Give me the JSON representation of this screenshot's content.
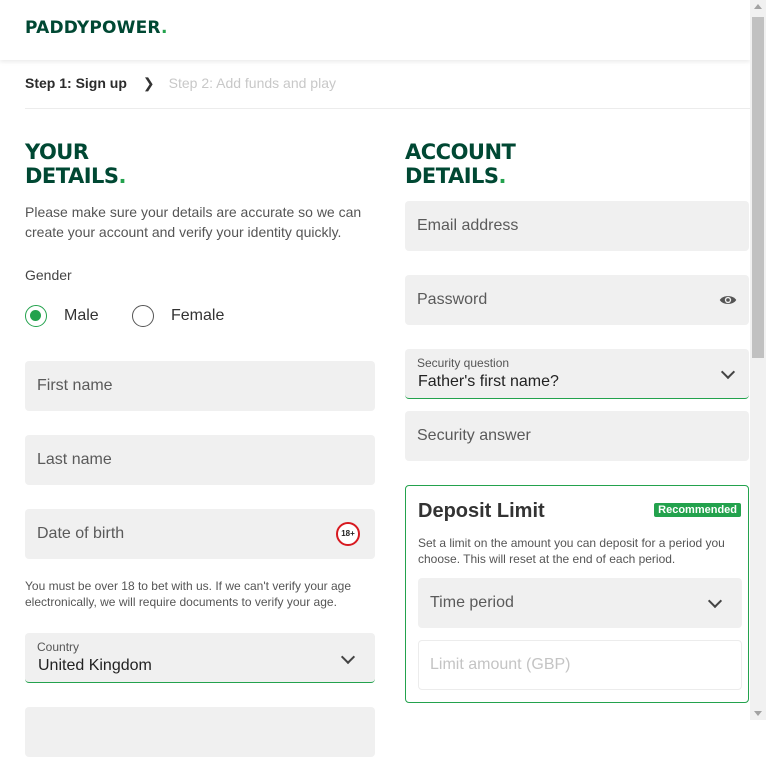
{
  "brand": {
    "logo_text": "PADDYPOWER",
    "logo_dot": ".",
    "primary": "#004833",
    "accent": "#23a24d"
  },
  "steps": {
    "step1": "Step 1: Sign up",
    "step2": "Step 2: Add funds and play",
    "separator_icon": "chevron-right-icon"
  },
  "your_details": {
    "title_line1": "YOUR",
    "title_line2": "DETAILS",
    "title_dot": ".",
    "intro": "Please make sure your details are accurate so we can create your account and verify your identity quickly.",
    "gender_label": "Gender",
    "gender_options": [
      {
        "label": "Male",
        "selected": true
      },
      {
        "label": "Female",
        "selected": false
      }
    ],
    "first_name_placeholder": "First name",
    "last_name_placeholder": "Last name",
    "dob_placeholder": "Date of birth",
    "age_badge": "18+",
    "age_note": "You must be over 18 to bet with us. If we can't verify your age electronically, we will require documents to verify your age.",
    "country_label": "Country",
    "country_value": "United Kingdom"
  },
  "account_details": {
    "title_line1": "ACCOUNT",
    "title_line2": "DETAILS",
    "title_dot": ".",
    "email_placeholder": "Email address",
    "password_placeholder": "Password",
    "password_toggle_icon": "eye-icon",
    "security_question_label": "Security question",
    "security_question_value": "Father's first name?",
    "security_answer_placeholder": "Security answer"
  },
  "deposit_limit": {
    "title": "Deposit Limit",
    "badge": "Recommended",
    "description": "Set a limit on the amount you can deposit for a period you choose. This will reset at the end of each period.",
    "time_period_placeholder": "Time period",
    "limit_amount_placeholder": "Limit amount (GBP)"
  }
}
